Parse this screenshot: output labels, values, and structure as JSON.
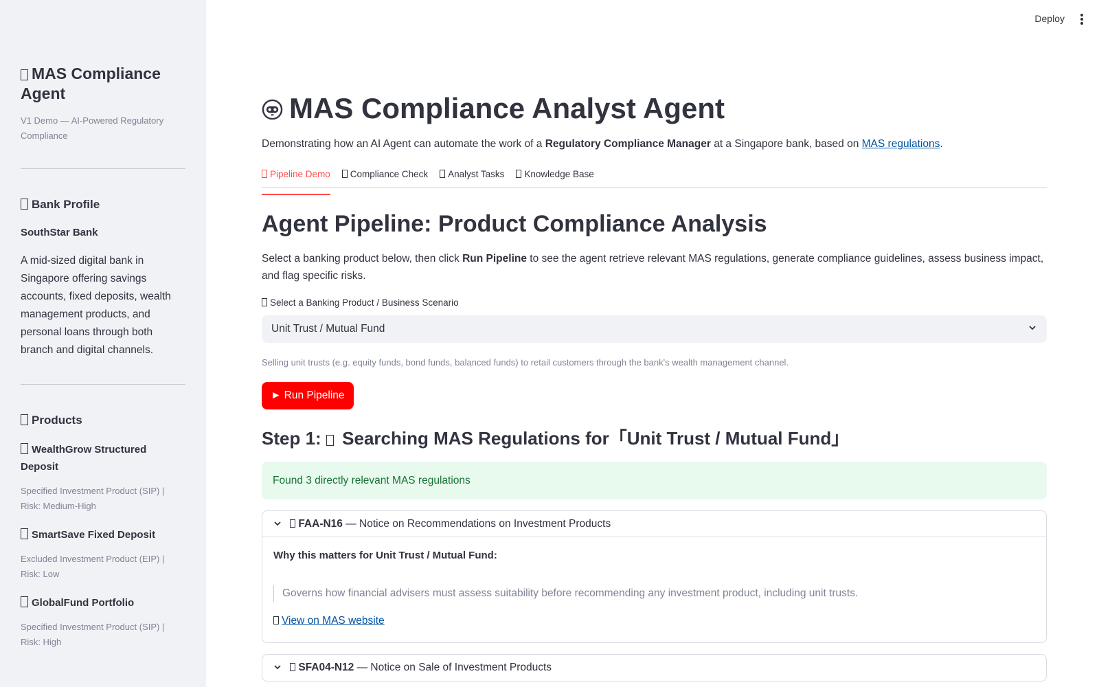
{
  "sidebar": {
    "app_title": "MAS Compliance Agent",
    "app_subtitle": "V1 Demo — AI-Powered Regulatory Compliance",
    "bank_profile_heading": "Bank Profile",
    "bank_name": "SouthStar Bank",
    "bank_description": "A mid-sized digital bank in Singapore offering savings accounts, fixed deposits, wealth management products, and personal loans through both branch and digital channels.",
    "products_heading": "Products",
    "products": [
      {
        "name": "WealthGrow Structured Deposit",
        "meta": "Specified Investment Product (SIP) | Risk: Medium-High"
      },
      {
        "name": "SmartSave Fixed Deposit",
        "meta": "Excluded Investment Product (EIP) | Risk: Low"
      },
      {
        "name": "GlobalFund Portfolio",
        "meta": "Specified Investment Product (SIP) | Risk: High"
      }
    ]
  },
  "topbar": {
    "deploy_label": "Deploy"
  },
  "main": {
    "title": "MAS Compliance Analyst Agent",
    "intro_pre": "Demonstrating how an AI Agent can automate the work of a ",
    "intro_bold": "Regulatory Compliance Manager",
    "intro_mid": " at a Singapore bank, based on ",
    "intro_link": "MAS regulations",
    "intro_post": ".",
    "tabs": [
      {
        "label": "Pipeline Demo",
        "active": true
      },
      {
        "label": "Compliance Check",
        "active": false
      },
      {
        "label": "Analyst Tasks",
        "active": false
      },
      {
        "label": "Knowledge Base",
        "active": false
      }
    ],
    "section_title": "Agent Pipeline: Product Compliance Analysis",
    "instructions_pre": "Select a banking product below, then click ",
    "instructions_bold": "Run Pipeline",
    "instructions_post": " to see the agent retrieve relevant MAS regulations, generate compliance guidelines, assess business impact, and flag specific risks.",
    "select_label": "Select a Banking Product / Business Scenario",
    "select_value": "Unit Trust / Mutual Fund",
    "select_help": "Selling unit trusts (e.g. equity funds, bond funds, balanced funds) to retail customers through the bank's wealth management channel.",
    "run_button": "► Run Pipeline",
    "step1_pre": "Step 1: ",
    "step1_post": " Searching MAS Regulations for「Unit Trust / Mutual Fund」",
    "success_msg": "Found 3 directly relevant MAS regulations",
    "regulations": [
      {
        "code": "FAA-N16",
        "title": " — Notice on Recommendations on Investment Products",
        "why_heading": "Why this matters for Unit Trust / Mutual Fund:",
        "quote": "Governs how financial advisers must assess suitability before recommending any investment product, including unit trusts.",
        "link_label": "View on MAS website"
      },
      {
        "code": "SFA04-N12",
        "title": " — Notice on Sale of Investment Products"
      }
    ]
  },
  "colors": {
    "accent": "#ff4b4b",
    "button": "#ff0000",
    "success_bg": "#e8f9ee",
    "success_text": "#177233",
    "link": "#0054a3"
  }
}
